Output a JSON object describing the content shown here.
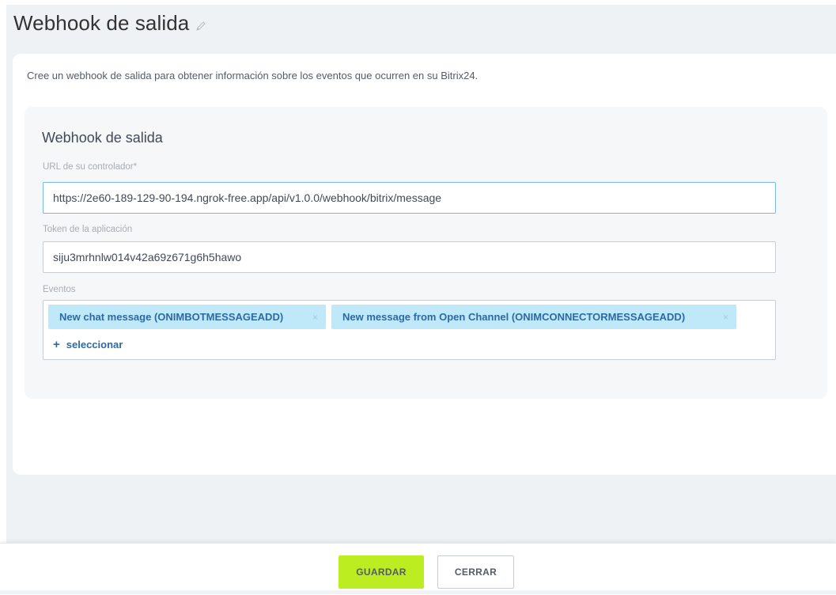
{
  "page": {
    "title": "Webhook de salida",
    "description": "Cree un webhook de salida para obtener información sobre los eventos que ocurren en su Bitrix24."
  },
  "form": {
    "heading": "Webhook de salida",
    "url_label": "URL de su controlador*",
    "url_value": "https://2e60-189-129-90-194.ngrok-free.app/api/v1.0.0/webhook/bitrix/message",
    "token_label": "Token de la aplicación",
    "token_value": "siju3mrhnlw014v42a69z671g6h5hawo",
    "events_label": "Eventos",
    "events": [
      {
        "label": "New chat message (ONIMBOTMESSAGEADD)",
        "close": "×"
      },
      {
        "label": "New message from Open Channel (ONIMCONNECTORMESSAGEADD)",
        "close": "×"
      }
    ],
    "add_event_label": "seleccionar",
    "add_event_icon": "+"
  },
  "footer": {
    "save_label": "GUARDAR",
    "close_label": "CERRAR"
  },
  "colors": {
    "save_button": "#bbed21",
    "tag_background": "#bfe8f8",
    "link": "#2d6aa3",
    "focused_border": "#78b7e8"
  },
  "icons": {
    "edit": "pencil-icon",
    "remove_tag": "close-icon",
    "add": "plus-icon"
  }
}
